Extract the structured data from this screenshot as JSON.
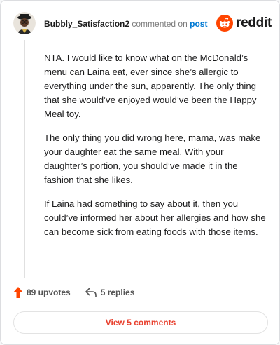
{
  "header": {
    "username": "Bubbly_Satisfaction2",
    "action_text": "commented on",
    "post_link": "post",
    "brand": "reddit"
  },
  "comment": {
    "paragraphs": [
      "NTA. I would like to know what on the McDonald’s menu can Laina eat, ever since she’s allergic to everything under the sun, apparently. The only thing that she would’ve enjoyed would’ve been the Happy Meal toy.",
      "The only thing you did wrong here, mama, was make your daughter eat the same meal. With your daughter’s portion, you should’ve made it in the fashion that she likes.",
      "If Laina had something to say about it, then you could’ve informed her about her allergies and how she can become sick from eating foods with those items."
    ]
  },
  "actions": {
    "upvotes_label": "89 upvotes",
    "replies_label": "5 replies"
  },
  "footer": {
    "view_comments_label": "View 5 comments"
  },
  "colors": {
    "accent_orange": "#ff4500",
    "link_blue": "#0079d3",
    "view_button_text": "#e8412f"
  },
  "icons": {
    "avatar": "avatar",
    "brand": "reddit-logo-icon",
    "upvote": "upvote-arrow-icon",
    "reply": "reply-arrow-icon"
  }
}
